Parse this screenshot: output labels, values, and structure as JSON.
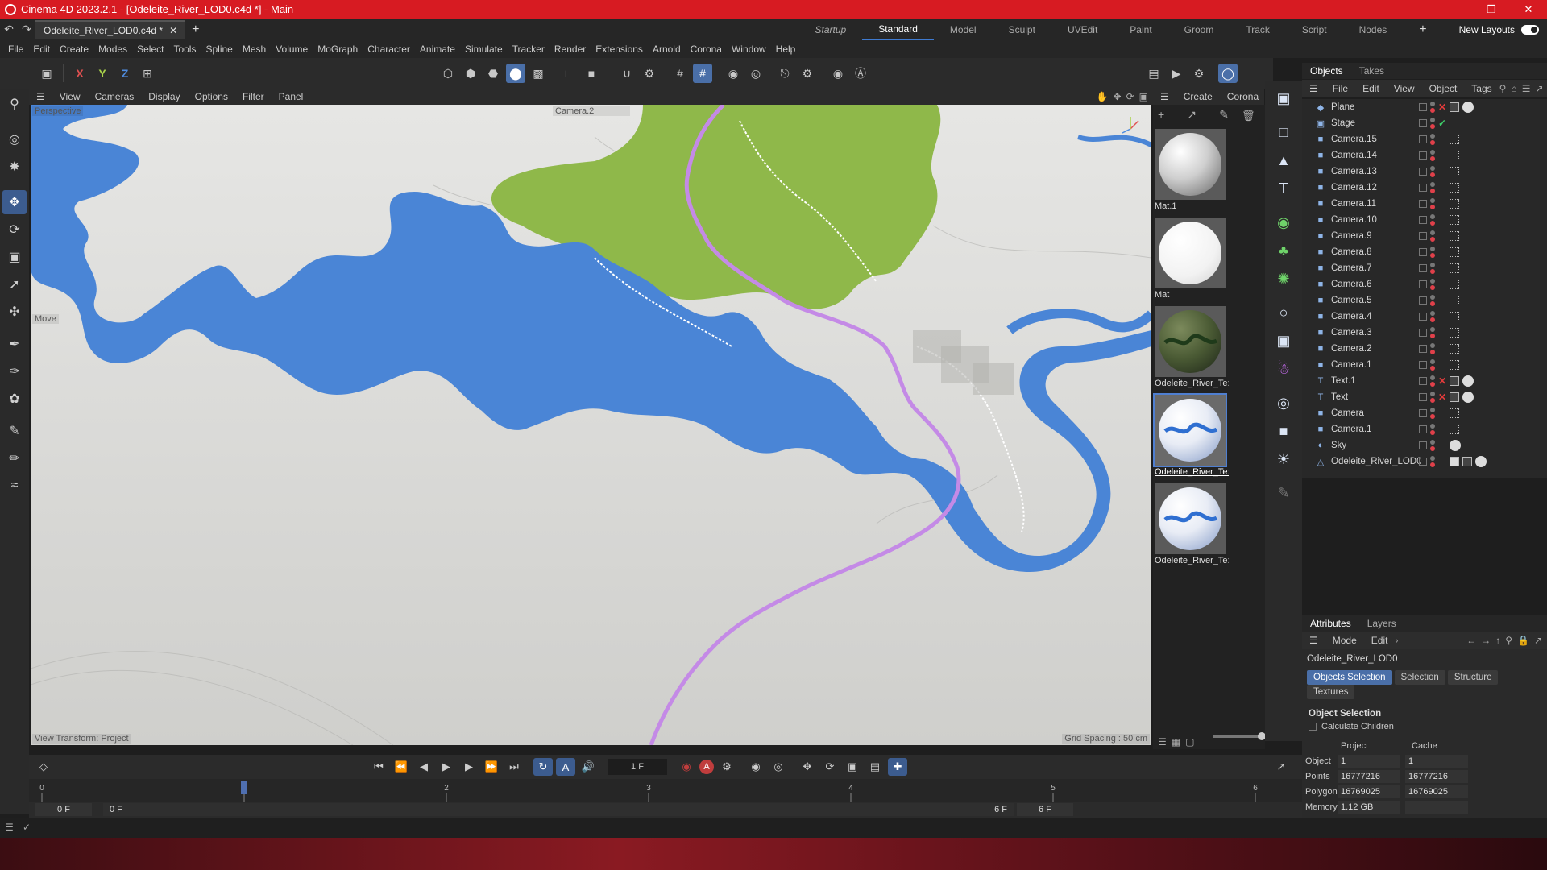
{
  "window": {
    "title": "Cinema 4D 2023.2.1 - [Odeleite_River_LOD0.c4d *] - Main"
  },
  "tabs": {
    "document": "Odeleite_River_LOD0.c4d *"
  },
  "layouts": {
    "items": [
      "Startup",
      "Standard",
      "Model",
      "Sculpt",
      "UVEdit",
      "Paint",
      "Groom",
      "Track",
      "Script",
      "Nodes"
    ],
    "active": "Standard",
    "new_layouts": "New Layouts"
  },
  "menu": {
    "items": [
      "File",
      "Edit",
      "Create",
      "Modes",
      "Select",
      "Tools",
      "Spline",
      "Mesh",
      "Volume",
      "MoGraph",
      "Character",
      "Animate",
      "Simulate",
      "Tracker",
      "Render",
      "Extensions",
      "Arnold",
      "Corona",
      "Window",
      "Help"
    ]
  },
  "toolbar": {
    "x": "X",
    "y": "Y",
    "z": "Z"
  },
  "viewport": {
    "menu": [
      "View",
      "Cameras",
      "Display",
      "Options",
      "Filter",
      "Panel"
    ],
    "view_name": "Perspective",
    "camera_name": "Camera.2",
    "tool_label": "Move",
    "view_transform": "View Transform: Project",
    "grid_spacing": "Grid Spacing : 50 cm",
    "colors": {
      "ground": "#d8d7d4",
      "water": "#4a85d6",
      "forest": "#8fb84a",
      "road": "#c48ae6"
    }
  },
  "materials": {
    "menu": [
      "Create",
      "Corona"
    ],
    "items": [
      {
        "name": "Mat.1",
        "type": "grey"
      },
      {
        "name": "Mat",
        "type": "white"
      },
      {
        "name": "Odeleite_River_Te:",
        "type": "terrain"
      },
      {
        "name": "Odeleite_River_Te:",
        "type": "river",
        "selected": true
      },
      {
        "name": "Odeleite_River_Te:",
        "type": "river"
      }
    ]
  },
  "objects": {
    "tabs": [
      "Objects",
      "Takes"
    ],
    "menu": [
      "File",
      "Edit",
      "View",
      "Object",
      "Tags"
    ],
    "items": [
      {
        "name": "Plane",
        "icon": "plane-icon",
        "tag": "x",
        "tags": [
          "phong",
          "material"
        ]
      },
      {
        "name": "Stage",
        "icon": "stage-icon",
        "tag": "ok",
        "tags": []
      },
      {
        "name": "Camera.15",
        "icon": "camera-icon",
        "tags": [
          "target"
        ]
      },
      {
        "name": "Camera.14",
        "icon": "camera-icon",
        "tags": [
          "target"
        ]
      },
      {
        "name": "Camera.13",
        "icon": "camera-icon",
        "tags": [
          "target"
        ]
      },
      {
        "name": "Camera.12",
        "icon": "camera-icon",
        "tags": [
          "target"
        ]
      },
      {
        "name": "Camera.11",
        "icon": "camera-icon",
        "tags": [
          "target"
        ]
      },
      {
        "name": "Camera.10",
        "icon": "camera-icon",
        "tags": [
          "target"
        ]
      },
      {
        "name": "Camera.9",
        "icon": "camera-icon",
        "tags": [
          "target"
        ]
      },
      {
        "name": "Camera.8",
        "icon": "camera-icon",
        "tags": [
          "target"
        ]
      },
      {
        "name": "Camera.7",
        "icon": "camera-icon",
        "tags": [
          "target"
        ]
      },
      {
        "name": "Camera.6",
        "icon": "camera-icon",
        "tags": [
          "target"
        ]
      },
      {
        "name": "Camera.5",
        "icon": "camera-icon",
        "tags": [
          "target"
        ]
      },
      {
        "name": "Camera.4",
        "icon": "camera-icon",
        "tags": [
          "target"
        ]
      },
      {
        "name": "Camera.3",
        "icon": "camera-icon",
        "tags": [
          "target"
        ]
      },
      {
        "name": "Camera.2",
        "icon": "camera-icon",
        "tags": [
          "target"
        ]
      },
      {
        "name": "Camera.1",
        "icon": "camera-icon",
        "tags": [
          "target"
        ]
      },
      {
        "name": "Text.1",
        "icon": "text-icon",
        "tag": "x",
        "tags": [
          "phong",
          "material"
        ]
      },
      {
        "name": "Text",
        "icon": "text-icon",
        "tag": "x",
        "tags": [
          "phong",
          "material"
        ]
      },
      {
        "name": "Camera",
        "icon": "camera-icon",
        "tags": [
          "target"
        ]
      },
      {
        "name": "Camera.1",
        "icon": "camera-icon",
        "tags": [
          "target"
        ]
      },
      {
        "name": "Sky",
        "icon": "sky-icon",
        "tags": [
          "material"
        ]
      },
      {
        "name": "Odeleite_River_LOD0",
        "icon": "polygon-icon",
        "tags": [
          "uv",
          "phong",
          "material"
        ]
      }
    ]
  },
  "attributes": {
    "tabs": [
      "Attributes",
      "Layers"
    ],
    "menu": [
      "Mode",
      "Edit"
    ],
    "object_name": "Odeleite_River_LOD0",
    "buttons": [
      "Objects Selection",
      "Selection",
      "Structure",
      "Textures"
    ],
    "section": "Object Selection",
    "calc_children": "Calculate Children",
    "col_headers": [
      "Project",
      "Cache"
    ],
    "rows": [
      {
        "label": "Object",
        "project": "1",
        "cache": "1"
      },
      {
        "label": "Points",
        "project": "16777216",
        "cache": "16777216"
      },
      {
        "label": "Polygons",
        "project": "16769025",
        "cache": "16769025"
      },
      {
        "label": "Memory",
        "project": "1.12 GB",
        "cache": ""
      }
    ]
  },
  "timeline": {
    "current_frame": "1 F",
    "ticks": [
      "0",
      "1",
      "2",
      "3",
      "4",
      "5",
      "6"
    ],
    "start": "0 F",
    "start2": "0 F",
    "end": "6 F",
    "end2": "6 F"
  }
}
